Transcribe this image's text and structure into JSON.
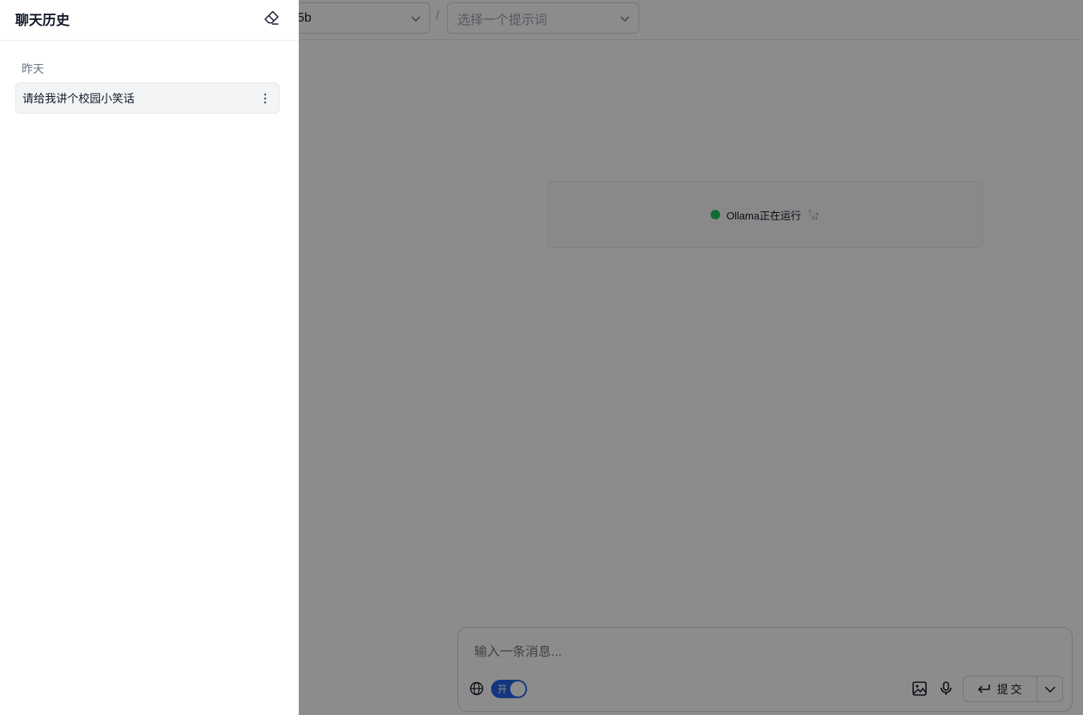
{
  "topbar": {
    "model_value": "5b",
    "separator": "/",
    "prompt_placeholder": "选择一个提示词"
  },
  "status": {
    "text": "Ollama正在运行",
    "emoji": "🦙",
    "dot_color": "#22c55e"
  },
  "composer": {
    "placeholder": "输入一条消息...",
    "web_toggle_label": "开",
    "web_toggle_on": true,
    "submit_label": "提交",
    "accent_color": "#2563eb"
  },
  "drawer": {
    "title": "聊天历史",
    "groups": [
      {
        "label": "昨天",
        "items": [
          {
            "title": "请给我讲个校园小笑话"
          }
        ]
      }
    ]
  },
  "icons": {
    "clear": "eraser-icon",
    "more": "more-vertical-icon",
    "globe": "globe-icon",
    "image": "image-icon",
    "mic": "mic-icon",
    "enter": "enter-icon",
    "chevron": "chevron-down-icon"
  }
}
